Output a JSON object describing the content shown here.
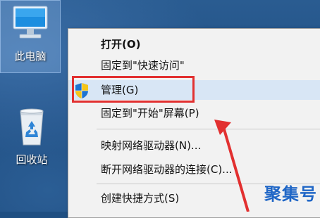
{
  "desktop": {
    "icons": [
      {
        "label": "此电脑",
        "icon": "computer-icon"
      },
      {
        "label": "回收站",
        "icon": "recycle-bin-icon"
      }
    ]
  },
  "context_menu": {
    "items": [
      {
        "label": "打开(O)",
        "bold": true
      },
      {
        "label": "固定到\"快速访问\""
      },
      {
        "label": "管理(G)",
        "icon": "uac-shield-icon"
      },
      {
        "label": "固定到\"开始\"屏幕(P)"
      },
      {
        "label": "映射网络驱动器(N)..."
      },
      {
        "label": "断开网络驱动器的连接(C)..."
      },
      {
        "label": "创建快捷方式(S)"
      }
    ]
  },
  "annotation": {
    "highlight_color": "#e23030",
    "arrow_color": "#e23030"
  },
  "watermark": {
    "text": "聚集号",
    "color": "#1f66c6"
  }
}
